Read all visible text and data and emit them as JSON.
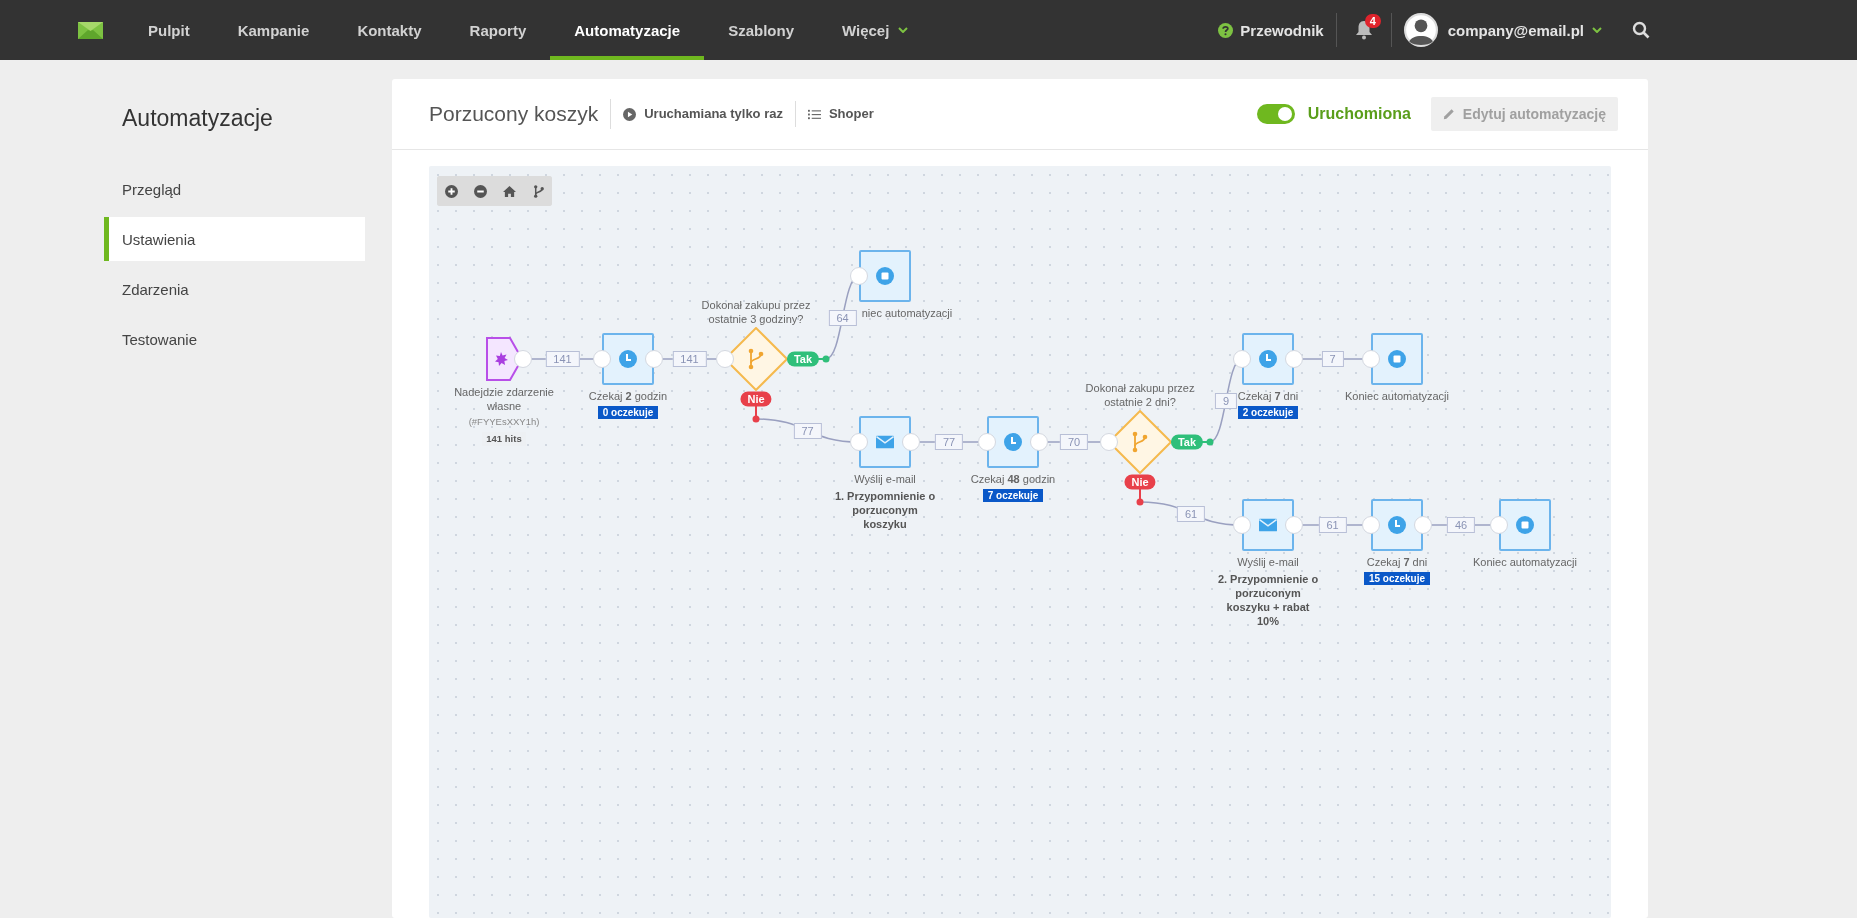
{
  "nav": {
    "items": [
      {
        "label": "Pulpit",
        "selected": false,
        "has_menu": false
      },
      {
        "label": "Kampanie",
        "selected": false,
        "has_menu": false
      },
      {
        "label": "Kontakty",
        "selected": false,
        "has_menu": false
      },
      {
        "label": "Raporty",
        "selected": false,
        "has_menu": false
      },
      {
        "label": "Automatyzacje",
        "selected": true,
        "has_menu": false
      },
      {
        "label": "Szablony",
        "selected": false,
        "has_menu": false
      },
      {
        "label": "Więcej",
        "selected": false,
        "has_menu": true
      }
    ],
    "help": {
      "label": "Przewodnik"
    },
    "notifications": {
      "count": "4"
    },
    "account": {
      "email": "company@email.pl"
    }
  },
  "sidebar": {
    "title": "Automatyzacje",
    "items": [
      {
        "label": "Przegląd",
        "selected": false
      },
      {
        "label": "Ustawienia",
        "selected": true
      },
      {
        "label": "Zdarzenia",
        "selected": false
      },
      {
        "label": "Testowanie",
        "selected": false
      }
    ]
  },
  "automation": {
    "title": "Porzucony koszyk",
    "meta": [
      {
        "kind": "run",
        "label": "Uruchamiana tylko raz"
      },
      {
        "kind": "store",
        "label": "Shoper"
      }
    ],
    "status": {
      "on": true,
      "label": "Uruchomiona"
    },
    "edit_button": {
      "label": "Edytuj automatyzację",
      "disabled": true
    }
  },
  "canvas": {
    "nodes": [
      {
        "kind": "trigger",
        "title": "Nadejdzie zdarzenie własne",
        "code": "(#FYYEsXXY1h)",
        "hits": "141 hits"
      },
      {
        "kind": "wait",
        "label": "Czekaj **2** godzin",
        "waiting": "0 oczekuje"
      },
      {
        "kind": "condition",
        "question": "Dokonał zakupu przez ostatnie 3 godziny?",
        "yes": "Tak",
        "no": "Nie"
      },
      {
        "kind": "end",
        "label": "niec automatyzacji"
      },
      {
        "kind": "email",
        "action": "Wyślij e-mail",
        "name": "1. Przypomnienie o porzuconym koszyku"
      },
      {
        "kind": "wait",
        "label": "Czekaj **48** godzin",
        "waiting": "7 oczekuje"
      },
      {
        "kind": "condition",
        "question": "Dokonał zakupu przez ostatnie 2 dni?",
        "yes": "Tak",
        "no": "Nie"
      },
      {
        "kind": "wait",
        "label": "Czekaj **7** dni",
        "waiting": "2 oczekuje"
      },
      {
        "kind": "end",
        "label": "Koniec automatyzacji"
      },
      {
        "kind": "email",
        "action": "Wyślij e-mail",
        "name": "2. Przypomnienie o porzuconym koszyku + rabat 10%"
      },
      {
        "kind": "wait",
        "label": "Czekaj **7** dni",
        "waiting": "15 oczekuje"
      },
      {
        "kind": "end",
        "label": "Koniec automatyzacji"
      }
    ],
    "edges": [
      {
        "count": "141"
      },
      {
        "count": "141"
      },
      {
        "count": "64"
      },
      {
        "count": "77"
      },
      {
        "count": "77"
      },
      {
        "count": "70"
      },
      {
        "count": "9"
      },
      {
        "count": "7"
      },
      {
        "count": "61"
      },
      {
        "count": "61"
      },
      {
        "count": "46"
      }
    ]
  }
}
